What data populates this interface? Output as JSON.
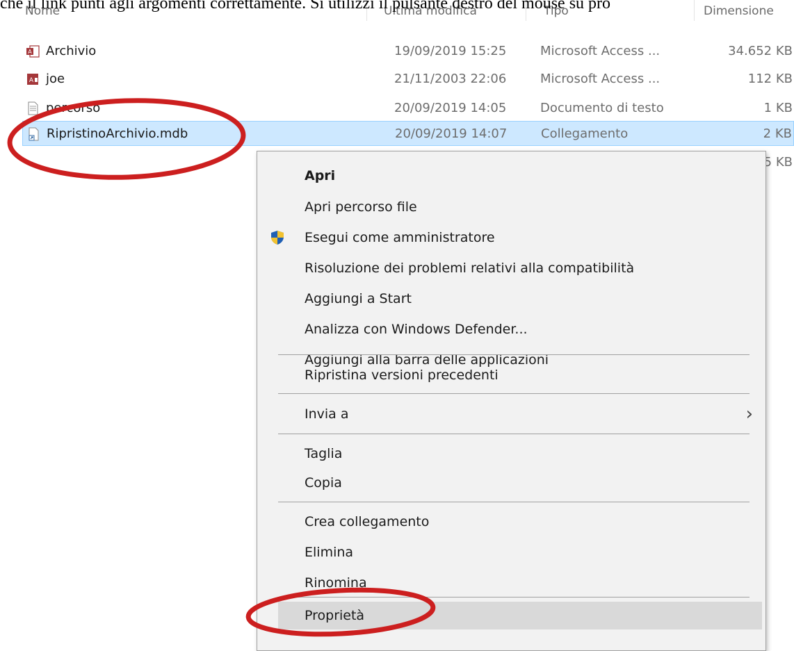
{
  "caption": "che il link punti agli argomenti correttamente. Si utilizzi il pulsante destro del mouse su pro",
  "columns": {
    "name": "Nome",
    "modified": "Ultima modifica",
    "type": "Tipo",
    "size": "Dimensione"
  },
  "files": [
    {
      "name": "Archivio",
      "modified": "19/09/2019 15:25",
      "type": "Microsoft Access ...",
      "size": "34.652 KB",
      "icon": "access-database-icon"
    },
    {
      "name": "joe",
      "modified": "21/11/2003 22:06",
      "type": "Microsoft Access ...",
      "size": "112 KB",
      "icon": "access-database-icon"
    },
    {
      "name": "percorso",
      "modified": "20/09/2019 14:05",
      "type": "Documento di testo",
      "size": "1 KB",
      "icon": "text-document-icon"
    },
    {
      "name": "RipristinoArchivio.mdb",
      "modified": "20/09/2019 14:07",
      "type": "Collegamento",
      "size": "2 KB",
      "icon": "shortcut-icon"
    },
    {
      "size": "5 KB"
    }
  ],
  "context_menu": {
    "items": [
      {
        "label": "Apri"
      },
      {
        "label": "Apri percorso file"
      },
      {
        "label": "Esegui come amministratore",
        "icon": "shield-icon"
      },
      {
        "label": "Risoluzione dei problemi relativi alla compatibilità"
      },
      {
        "label": "Aggiungi a Start"
      },
      {
        "label": "Analizza con Windows Defender..."
      },
      {
        "label": "Aggiungi alla barra delle applicazioni"
      },
      {
        "label": "Ripristina versioni precedenti"
      },
      {
        "label": "Invia a",
        "submenu_icon": "chevron-right-icon"
      },
      {
        "label": "Taglia"
      },
      {
        "label": "Copia"
      },
      {
        "label": "Crea collegamento"
      },
      {
        "label": "Elimina"
      },
      {
        "label": "Rinomina"
      },
      {
        "label": "Proprietà"
      }
    ]
  },
  "colors": {
    "selection": "#cde8ff",
    "menu_background": "#f2f2f2",
    "menu_hover": "#d9d9d9",
    "annotation": "#cc1f1f"
  }
}
